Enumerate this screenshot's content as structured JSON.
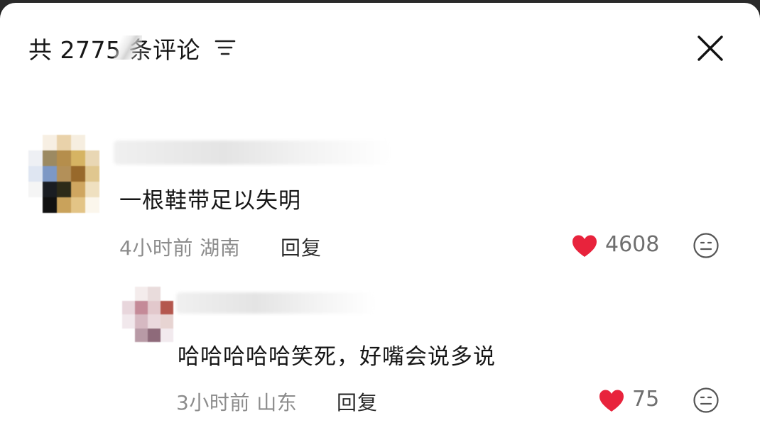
{
  "header": {
    "title": "共 2775 条评论",
    "filter_icon": "filter-lines-icon",
    "close_icon": "close-icon"
  },
  "comments": [
    {
      "text": "一根鞋带足以失明",
      "time": "4小时前",
      "location": "湖南",
      "reply_label": "回复",
      "likes": "4608"
    },
    {
      "text": "哈哈哈哈哈笑死，好嘴会说多说",
      "time": "3小时前",
      "location": "山东",
      "reply_label": "回复",
      "likes": "75"
    }
  ],
  "colors": {
    "heart": "#e8233c",
    "secondary_text": "#8c8c8c",
    "primary_text": "#151515"
  }
}
